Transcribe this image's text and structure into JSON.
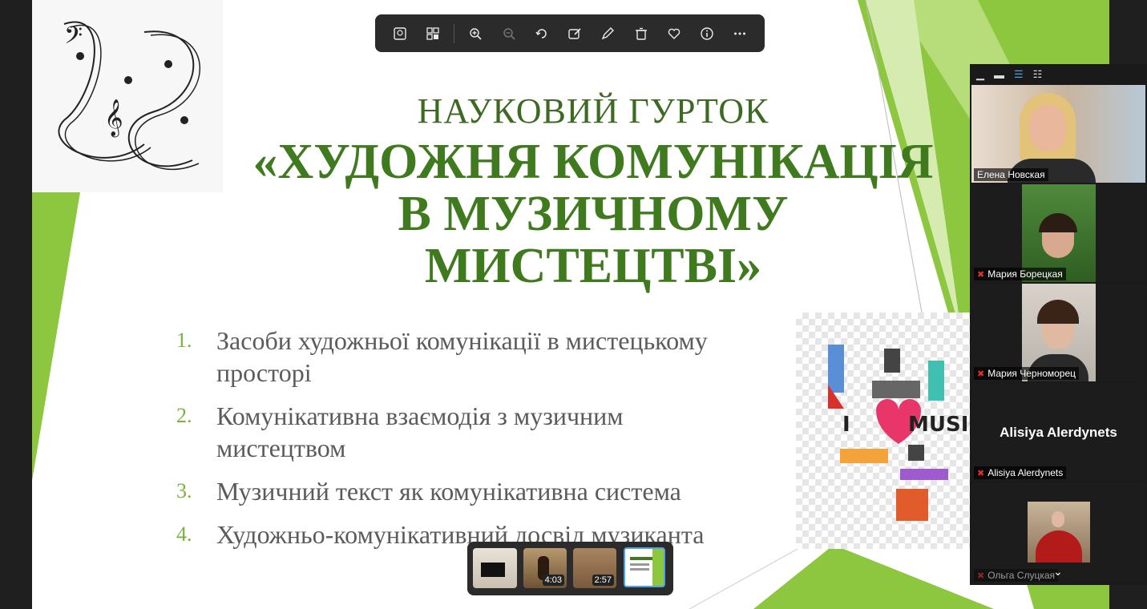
{
  "slide": {
    "title_line1": "НАУКОВИЙ ГУРТОК",
    "title_line2": "«ХУДОЖНЯ КОМУНІКАЦІЯ",
    "title_line3": "В МУЗИЧНОМУ",
    "title_line4": "МИСТЕЦТВІ»",
    "items": [
      {
        "num": "1.",
        "text": "Засоби художньої комунікації в мистецькому просторі"
      },
      {
        "num": "2.",
        "text": "Комунікативна взаємодія з музичним мистецтвом"
      },
      {
        "num": "3.",
        "text": "Музичний текст як комунікативна система"
      },
      {
        "num": "4.",
        "text": "Художньо-комунікативний досвід музиканта"
      }
    ],
    "image_lettering": "I ♥ MUSIC",
    "colors": {
      "title": "#3f7a1f",
      "number": "#7ab33c",
      "accent_green": "#8dc63f"
    }
  },
  "toolbar": {
    "icons": [
      "image-icon",
      "collage-icon",
      "zoom-in-icon",
      "zoom-out-icon",
      "rotate-icon",
      "edit-image-icon",
      "draw-icon",
      "delete-icon",
      "favorite-icon",
      "info-icon",
      "more-icon"
    ]
  },
  "thumbnails": [
    {
      "duration": ""
    },
    {
      "duration": "4:03"
    },
    {
      "duration": "2:57"
    },
    {
      "duration": ""
    }
  ],
  "participants": [
    {
      "name": "Елена Новская",
      "muted": false
    },
    {
      "name": "Мария Борецкая",
      "muted": true
    },
    {
      "name": "Мария Черноморец",
      "muted": true
    },
    {
      "name": "Alisiya Alerdynets",
      "muted": true,
      "display_name": "Alisiya Alerdynets"
    },
    {
      "name": "Ольга Слуцкая",
      "muted": true
    }
  ]
}
